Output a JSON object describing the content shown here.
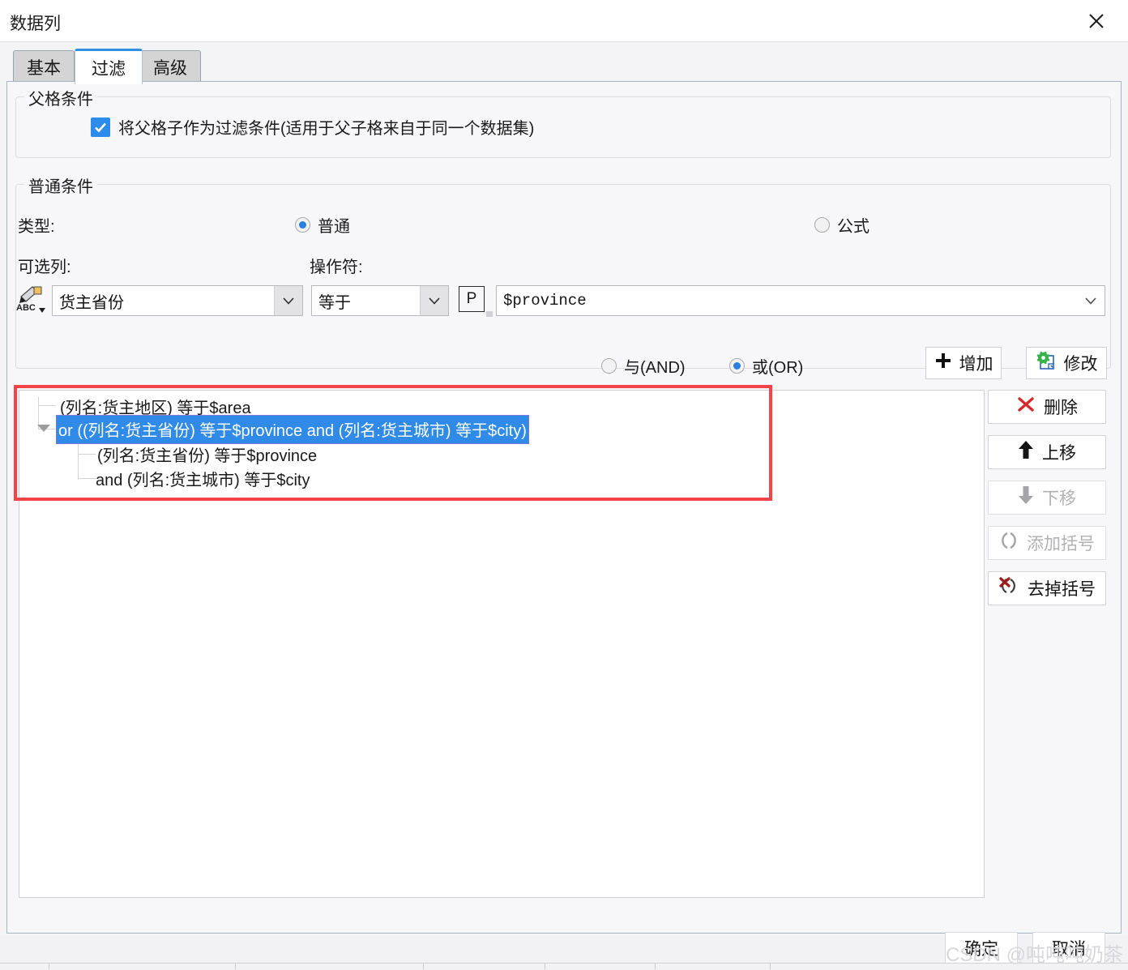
{
  "window": {
    "title": "数据列",
    "close_icon": "close-icon"
  },
  "tabs": [
    {
      "id": "basic",
      "label": "基本",
      "selected": false
    },
    {
      "id": "filter",
      "label": "过滤",
      "selected": true
    },
    {
      "id": "advanced",
      "label": "高级",
      "selected": false
    }
  ],
  "parent_group": {
    "legend": "父格条件",
    "checkbox_label": "将父格子作为过滤条件(适用于父子格来自于同一个数据集)",
    "checkbox_checked": true
  },
  "normal_group": {
    "legend": "普通条件",
    "type_label": "类型:",
    "type_options": [
      {
        "label": "普通",
        "selected": true
      },
      {
        "label": "公式",
        "selected": false
      }
    ],
    "column_label": "可选列:",
    "operator_label": "操作符:",
    "column_value": "货主省份",
    "column_icon": "abc-column-icon",
    "operator_value": "等于",
    "param_button": "P",
    "value_field": "$province",
    "logic_options": [
      {
        "label": "与(AND)",
        "selected": false
      },
      {
        "label": "或(OR)",
        "selected": true
      }
    ],
    "add_button": "增加",
    "modify_button": "修改"
  },
  "tree": {
    "rows": [
      {
        "level": 1,
        "selected": false,
        "text": "(列名:货主地区) 等于$area"
      },
      {
        "level": 1,
        "selected": true,
        "expanded": true,
        "text": "or  ((列名:货主省份) 等于$province and (列名:货主城市) 等于$city)"
      },
      {
        "level": 2,
        "selected": false,
        "text": "(列名:货主省份) 等于$province"
      },
      {
        "level": 2,
        "selected": false,
        "text": "and (列名:货主城市) 等于$city"
      }
    ]
  },
  "side_buttons": [
    {
      "id": "delete",
      "label": "删除",
      "icon": "red-x-icon",
      "disabled": false
    },
    {
      "id": "move-up",
      "label": "上移",
      "icon": "arrow-up-icon",
      "disabled": false
    },
    {
      "id": "move-down",
      "label": "下移",
      "icon": "arrow-down-icon",
      "disabled": true
    },
    {
      "id": "add-paren",
      "label": "添加括号",
      "icon": "parenthesis-icon",
      "disabled": true
    },
    {
      "id": "remove-paren",
      "label": "去掉括号",
      "icon": "remove-parenthesis-icon",
      "disabled": false
    }
  ],
  "footer": {
    "ok_label": "确定",
    "cancel_label": "取消"
  },
  "watermark": "CSDN @吨吨吨奶茶",
  "colors": {
    "accent_blue": "#2f8ae8",
    "checkbox_blue": "#2b8ceb",
    "annotation_red": "#f4444a",
    "delete_red": "#d42a2a",
    "gear_green": "#35b34a"
  }
}
